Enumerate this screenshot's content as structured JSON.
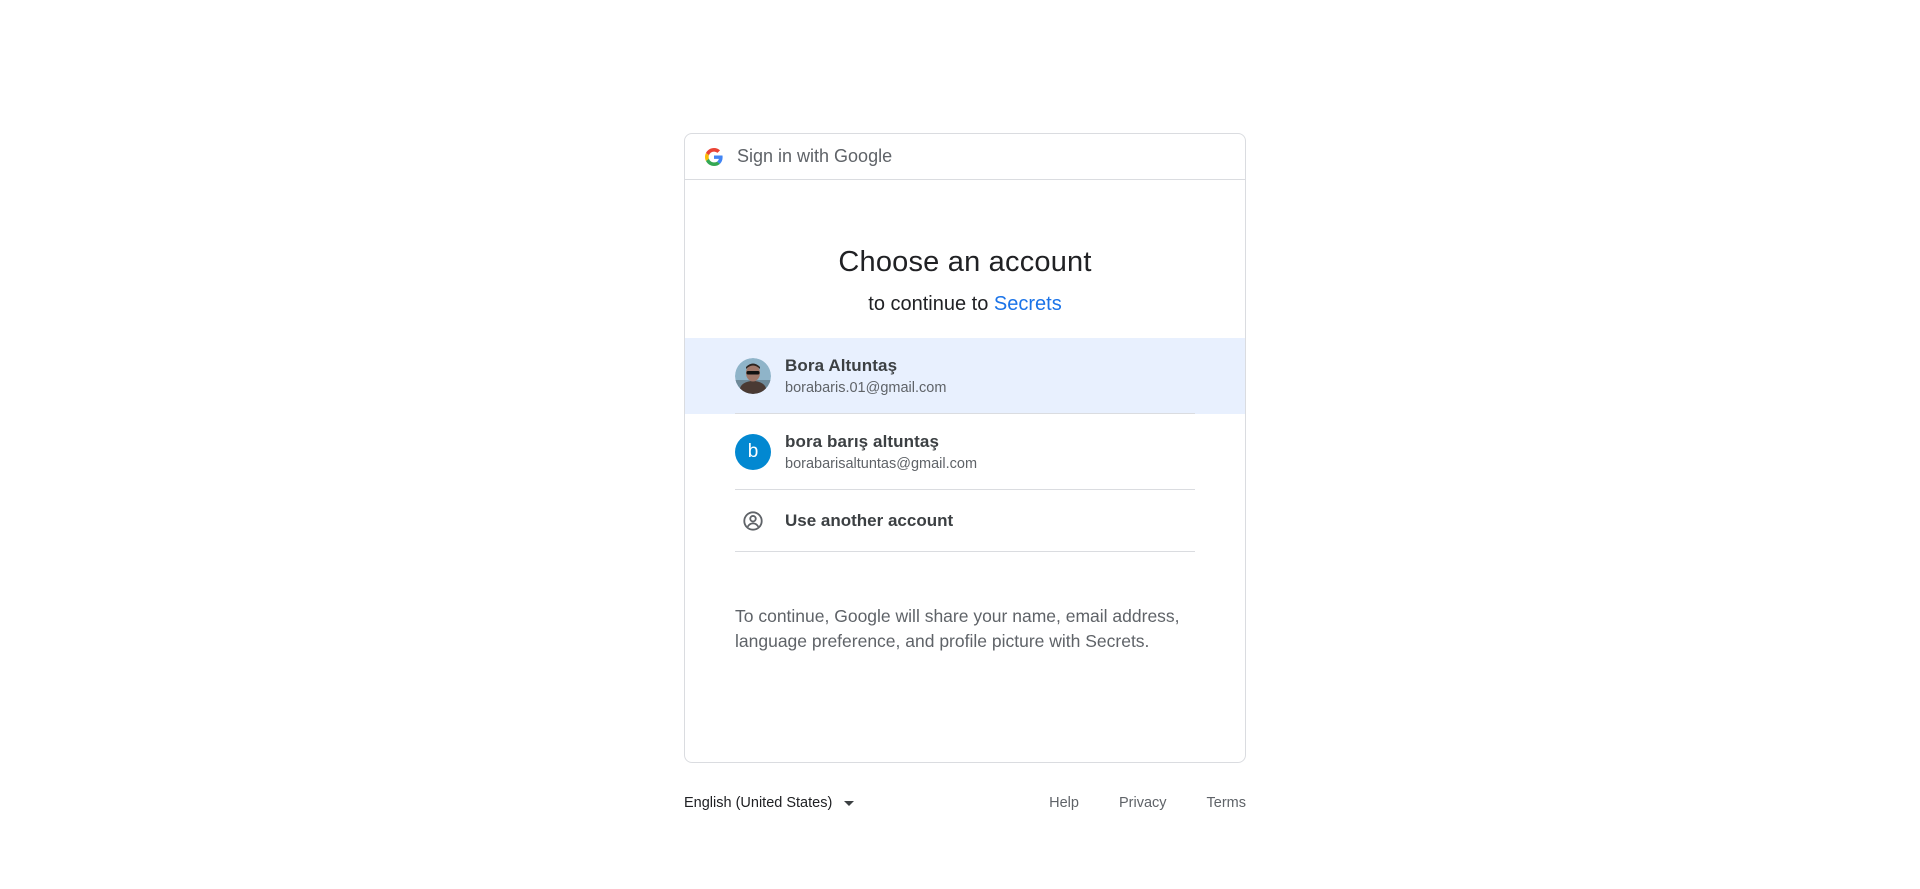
{
  "header": {
    "title": "Sign in with Google"
  },
  "main": {
    "title": "Choose an account",
    "subtitle_prefix": "to continue to",
    "app_name": "Secrets"
  },
  "accounts": [
    {
      "name": "Bora Altuntaş",
      "email": "borabaris.01@gmail.com",
      "avatar": "photo",
      "selected": true
    },
    {
      "name": "bora barış altuntaş",
      "email": "borabarisaltuntas@gmail.com",
      "avatar_letter": "b",
      "avatar_color": "#0288d1",
      "selected": false
    }
  ],
  "use_another": {
    "label": "Use another account",
    "icon": "account-circle-icon"
  },
  "disclaimer": "To continue, Google will share your name, email address, language preference, and profile picture with Secrets.",
  "footer": {
    "language": "English (United States)",
    "links": [
      "Help",
      "Privacy",
      "Terms"
    ]
  },
  "colors": {
    "accent": "#1a73e8",
    "selected_bg": "#e8f0fe",
    "border": "#dadce0"
  }
}
